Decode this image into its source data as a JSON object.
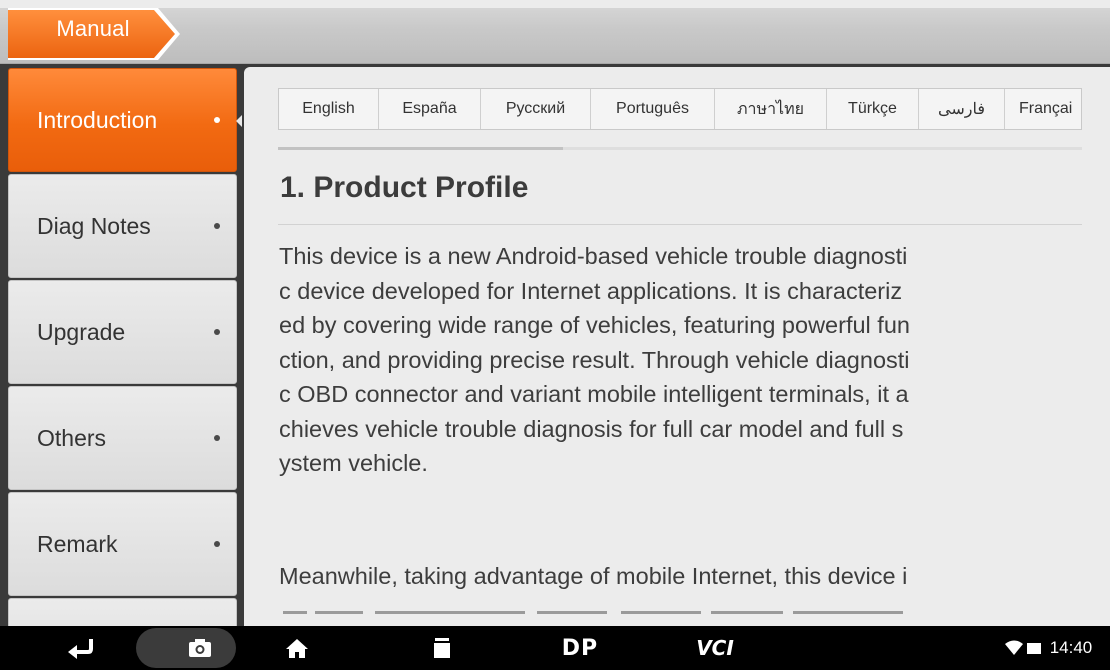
{
  "header": {
    "title": "Manual"
  },
  "sidebar": {
    "items": [
      {
        "label": "Introduction",
        "active": true
      },
      {
        "label": "Diag Notes",
        "active": false
      },
      {
        "label": "Upgrade",
        "active": false
      },
      {
        "label": "Others",
        "active": false
      },
      {
        "label": "Remark",
        "active": false
      }
    ]
  },
  "content": {
    "languages": [
      "English",
      "España",
      "Русский",
      "Português",
      "ภาษาไทย",
      "Türkçe",
      "فارسی",
      "Françai"
    ],
    "heading": "1. Product Profile",
    "paragraph1_lines": [
      "This device is a new Android-based vehicle trouble diagnosti",
      "c device developed for Internet applications. It is characteriz",
      "ed by covering wide range of vehicles, featuring powerful fun",
      "ction, and providing precise result. Through vehicle diagnosti",
      "c OBD connector and variant mobile intelligent terminals, it a",
      "chieves vehicle trouble diagnosis for full car model and full s",
      "ystem vehicle."
    ],
    "paragraph2_lines": [
      "Meanwhile, taking advantage of mobile Internet, this device i"
    ]
  },
  "navbar": {
    "dp_label": "DP",
    "vci_label": "VCI",
    "time": "14:40"
  },
  "colors": {
    "accent": "#f26a12",
    "panel": "#ececec",
    "sidebar_item": "#e3e3e3"
  }
}
